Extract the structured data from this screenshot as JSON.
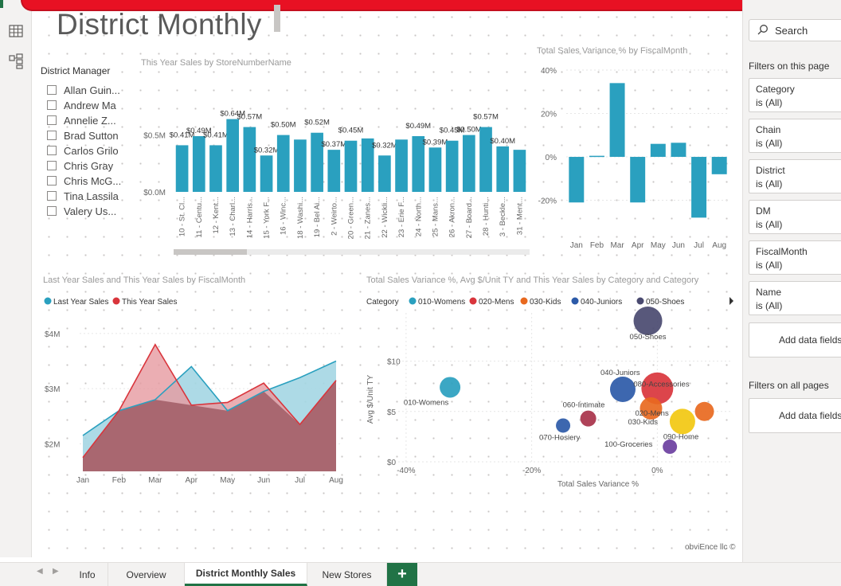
{
  "page": {
    "title": "District Monthly",
    "credit": "obviEnce llc ©"
  },
  "rail": {
    "icons": [
      "table-icon",
      "model-icon"
    ]
  },
  "slicer": {
    "title": "District Manager",
    "items": [
      "Allan Guin...",
      "Andrew Ma",
      "Annelie Z...",
      "Brad Sutton",
      "Carlos Grilo",
      "Chris Gray",
      "Chris McG...",
      "Tina Lassila",
      "Valery Us..."
    ]
  },
  "visuals": {
    "store_title": "This Year Sales by StoreNumberName",
    "variance_title": "Total Sales Variance % by FiscalMonth",
    "area_title": "Last Year Sales and This Year Sales by FiscalMonth",
    "scatter_title": "Total Sales Variance %, Avg $/Unit TY and This Year Sales by Category and Category"
  },
  "colors": {
    "teal": "#2aa0bf",
    "red": "#d9353c",
    "area_teal_fill": "#a4d6e3",
    "area_red_fill": "#e69aa0",
    "overlap": "#a6636d",
    "brand_green": "#217346"
  },
  "chart_data": [
    {
      "type": "bar",
      "title": "This Year Sales by StoreNumberName",
      "categories": [
        "10 - St. Cl...",
        "11 - Centu...",
        "12 - Kent...",
        "13 - Charl...",
        "14 - Harris...",
        "15 - York F...",
        "16 - Winc...",
        "18 - Washi...",
        "19 - Bel Ai...",
        "2 - Weirto...",
        "20 - Green...",
        "21 - Zanes...",
        "22 - Wickli...",
        "23 - Erie F...",
        "24 - North...",
        "25 - Mans...",
        "26 - Akron...",
        "27 - Board...",
        "28 - Hunti...",
        "3 - Beckle...",
        "31 - Ment..."
      ],
      "values": [
        0.41,
        0.49,
        0.41,
        0.64,
        0.57,
        0.32,
        0.5,
        0.46,
        0.52,
        0.37,
        0.45,
        0.47,
        0.32,
        0.46,
        0.49,
        0.39,
        0.45,
        0.5,
        0.57,
        0.4,
        0.37
      ],
      "data_labels": [
        "$0.41M",
        "$0.49M",
        "$0.41M",
        "$0.64M",
        "$0.57M",
        "$0.32M",
        "$0.50M",
        "",
        "$0.52M",
        "$0.37M",
        "$0.45M",
        "",
        "$0.32M",
        "",
        "$0.49M",
        "$0.39M",
        "$0.45M",
        "$0.50M",
        "$0.57M",
        "$0.40M",
        ""
      ],
      "yticks": [
        "$0.0M",
        "$0.5M"
      ],
      "ylim": [
        0,
        0.7
      ],
      "color": "#2aa0bf"
    },
    {
      "type": "bar",
      "title": "Total Sales Variance % by FiscalMonth",
      "categories": [
        "Jan",
        "Feb",
        "Mar",
        "Apr",
        "May",
        "Jun",
        "Jul",
        "Aug"
      ],
      "values": [
        -21,
        0.5,
        34,
        -21,
        6,
        6.5,
        -28,
        -8
      ],
      "yticks": [
        "40%",
        "20%",
        "0%",
        "-20%"
      ],
      "ylim": [
        -30,
        40
      ],
      "color": "#2aa0bf"
    },
    {
      "type": "area",
      "title": "Last Year Sales and This Year Sales by FiscalMonth",
      "categories": [
        "Jan",
        "Feb",
        "Mar",
        "Apr",
        "May",
        "Jun",
        "Jul",
        "Aug"
      ],
      "series": [
        {
          "name": "Last Year Sales",
          "values": [
            2.15,
            2.6,
            2.8,
            3.4,
            2.6,
            2.95,
            3.2,
            3.5
          ],
          "color": "#2aa0bf"
        },
        {
          "name": "This Year Sales",
          "values": [
            1.75,
            2.6,
            3.8,
            2.7,
            2.75,
            3.1,
            2.35,
            3.15
          ],
          "color": "#d9353c"
        }
      ],
      "yticks": [
        "$2M",
        "$3M",
        "$4M"
      ],
      "ylim": [
        1.5,
        4.2
      ]
    },
    {
      "type": "scatter",
      "title": "Total Sales Variance %, Avg $/Unit TY and This Year Sales by Category and Category",
      "legend_title": "Category",
      "legend": [
        {
          "name": "010-Womens",
          "color": "#2aa0bf"
        },
        {
          "name": "020-Mens",
          "color": "#d9353c"
        },
        {
          "name": "030-Kids",
          "color": "#e8691f"
        },
        {
          "name": "040-Juniors",
          "color": "#2c5aa8"
        },
        {
          "name": "050-Shoes",
          "color": "#4a4a70"
        }
      ],
      "xlabel": "Total Sales Variance %",
      "ylabel": "Avg $/Unit TY",
      "xticks": [
        "-40%",
        "-20%",
        "0%"
      ],
      "yticks": [
        "$0",
        "$5",
        "$10"
      ],
      "xlim": [
        -41,
        12
      ],
      "ylim": [
        0,
        14
      ],
      "points": [
        {
          "name": "010-Womens",
          "x": -33,
          "y": 7.4,
          "size": 13,
          "color": "#2aa0bf"
        },
        {
          "name": "050-Shoes",
          "x": -1.5,
          "y": 14,
          "size": 18,
          "color": "#4a4a70"
        },
        {
          "name": "040-Juniors",
          "x": -5.5,
          "y": 7.2,
          "size": 16,
          "color": "#2c5aa8"
        },
        {
          "name": "080-Accessories",
          "x": 0,
          "y": 7.3,
          "size": 20,
          "color": "#d9353c"
        },
        {
          "name": "020-Mens",
          "x": -1,
          "y": 5.3,
          "size": 14,
          "color": "#e8691f"
        },
        {
          "name": "030-Kids",
          "x": 7.5,
          "y": 5,
          "size": 12,
          "color": "#e8691f"
        },
        {
          "name": "060-Intimate",
          "x": -11,
          "y": 4.3,
          "size": 10,
          "color": "#a8324a"
        },
        {
          "name": "070-Hosiery",
          "x": -15,
          "y": 3.6,
          "size": 9,
          "color": "#2c5aa8"
        },
        {
          "name": "090-Home",
          "x": 4,
          "y": 4,
          "size": 16,
          "color": "#f2c811"
        },
        {
          "name": "100-Groceries",
          "x": 2,
          "y": 1.5,
          "size": 9,
          "color": "#6b3fa0"
        }
      ]
    }
  ],
  "pane": {
    "search_placeholder": "Search",
    "filters_page_heading": "Filters on this page",
    "filters_all_heading": "Filters on all pages",
    "page_filters": [
      {
        "field": "Category",
        "value": "is (All)"
      },
      {
        "field": "Chain",
        "value": "is (All)"
      },
      {
        "field": "District",
        "value": "is (All)"
      },
      {
        "field": "DM",
        "value": "is (All)"
      },
      {
        "field": "FiscalMonth",
        "value": "is (All)"
      },
      {
        "field": "Name",
        "value": "is (All)"
      }
    ],
    "add_fields_label": "Add data fields"
  },
  "tabs": [
    {
      "label": "Info",
      "active": false
    },
    {
      "label": "Overview",
      "active": false
    },
    {
      "label": "District Monthly Sales",
      "active": true
    },
    {
      "label": "New Stores",
      "active": false
    }
  ],
  "tab_add_label": "+"
}
